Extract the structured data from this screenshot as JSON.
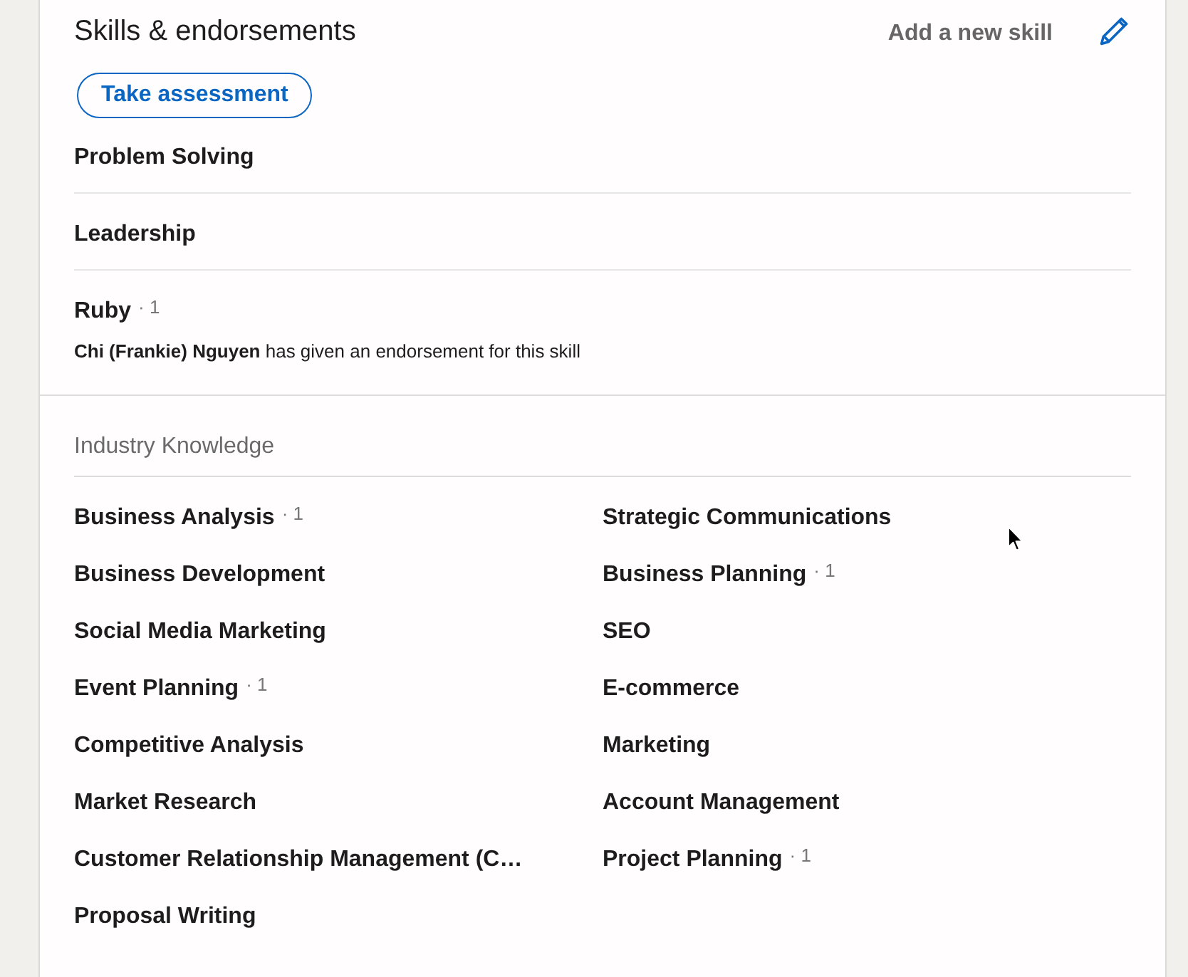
{
  "section": {
    "title": "Skills & endorsements",
    "add_link": "Add a new skill",
    "assessment_button": "Take assessment"
  },
  "top_skills": [
    {
      "name": "Problem Solving"
    },
    {
      "name": "Leadership"
    },
    {
      "name": "Ruby",
      "count": "· 1",
      "endorsement": "**Chi (Frankie) Nguyen** has given an endorsement for this skill"
    }
  ],
  "categories": [
    {
      "title": "Industry Knowledge",
      "skills": [
        {
          "name": "Business Analysis",
          "count": "· 1"
        },
        {
          "name": "Strategic Communications"
        },
        {
          "name": "Business Development"
        },
        {
          "name": "Business Planning",
          "count": "· 1"
        },
        {
          "name": "Social Media Marketing"
        },
        {
          "name": "SEO"
        },
        {
          "name": "Event Planning",
          "count": "· 1"
        },
        {
          "name": "E-commerce"
        },
        {
          "name": "Competitive Analysis"
        },
        {
          "name": "Marketing"
        },
        {
          "name": "Market Research"
        },
        {
          "name": "Account Management"
        },
        {
          "name": "Customer Relationship Management (C…"
        },
        {
          "name": "Project Planning",
          "count": "· 1"
        },
        {
          "name": "Proposal Writing"
        }
      ]
    }
  ]
}
